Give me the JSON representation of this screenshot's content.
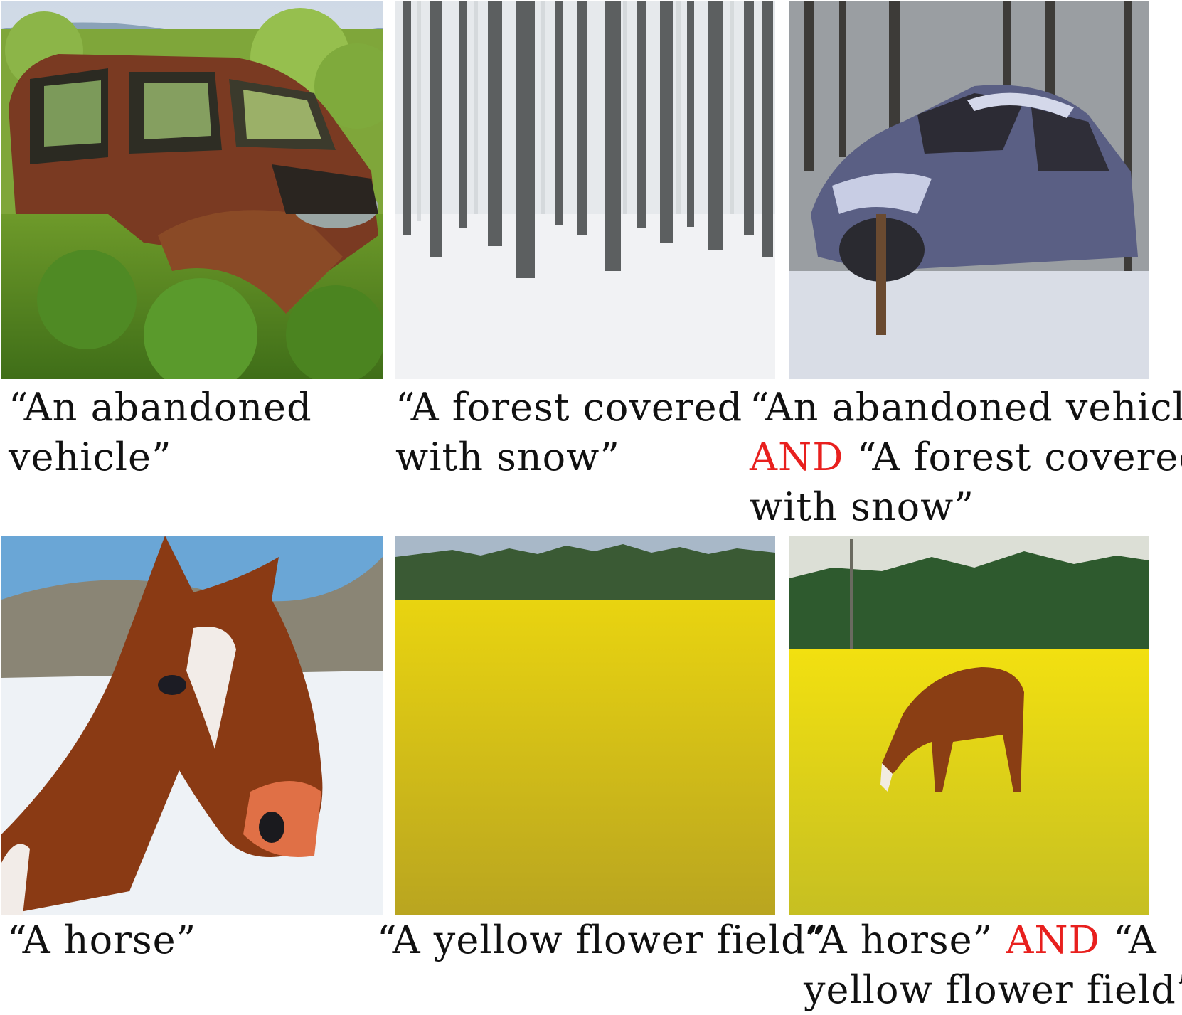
{
  "panels": [
    {
      "image": "abandoned-rusty-car-in-grass",
      "caption_lines": [
        "“An abandoned",
        "vehicle”"
      ]
    },
    {
      "image": "snowy-birch-forest",
      "caption_lines": [
        "“A forest covered",
        "with snow”"
      ]
    },
    {
      "image": "abandoned-car-in-snowy-forest",
      "caption": {
        "line1": "“An abandoned vehicle”",
        "and_word": "AND",
        "line2_rest": " “A forest covered",
        "line3": "with snow”"
      }
    },
    {
      "image": "horse-head-snowy-hills",
      "caption_lines": [
        "“A horse”"
      ]
    },
    {
      "image": "yellow-flower-field",
      "caption_lines": [
        "“A yellow flower field”"
      ]
    },
    {
      "image": "horse-grazing-yellow-field",
      "caption": {
        "line1_start": "“A horse” ",
        "and_word": "AND",
        "line1_end": " “A",
        "line2": "yellow flower field”"
      }
    }
  ],
  "colors": {
    "and_highlight": "#e8201e",
    "text": "#111111",
    "background": "#ffffff"
  }
}
